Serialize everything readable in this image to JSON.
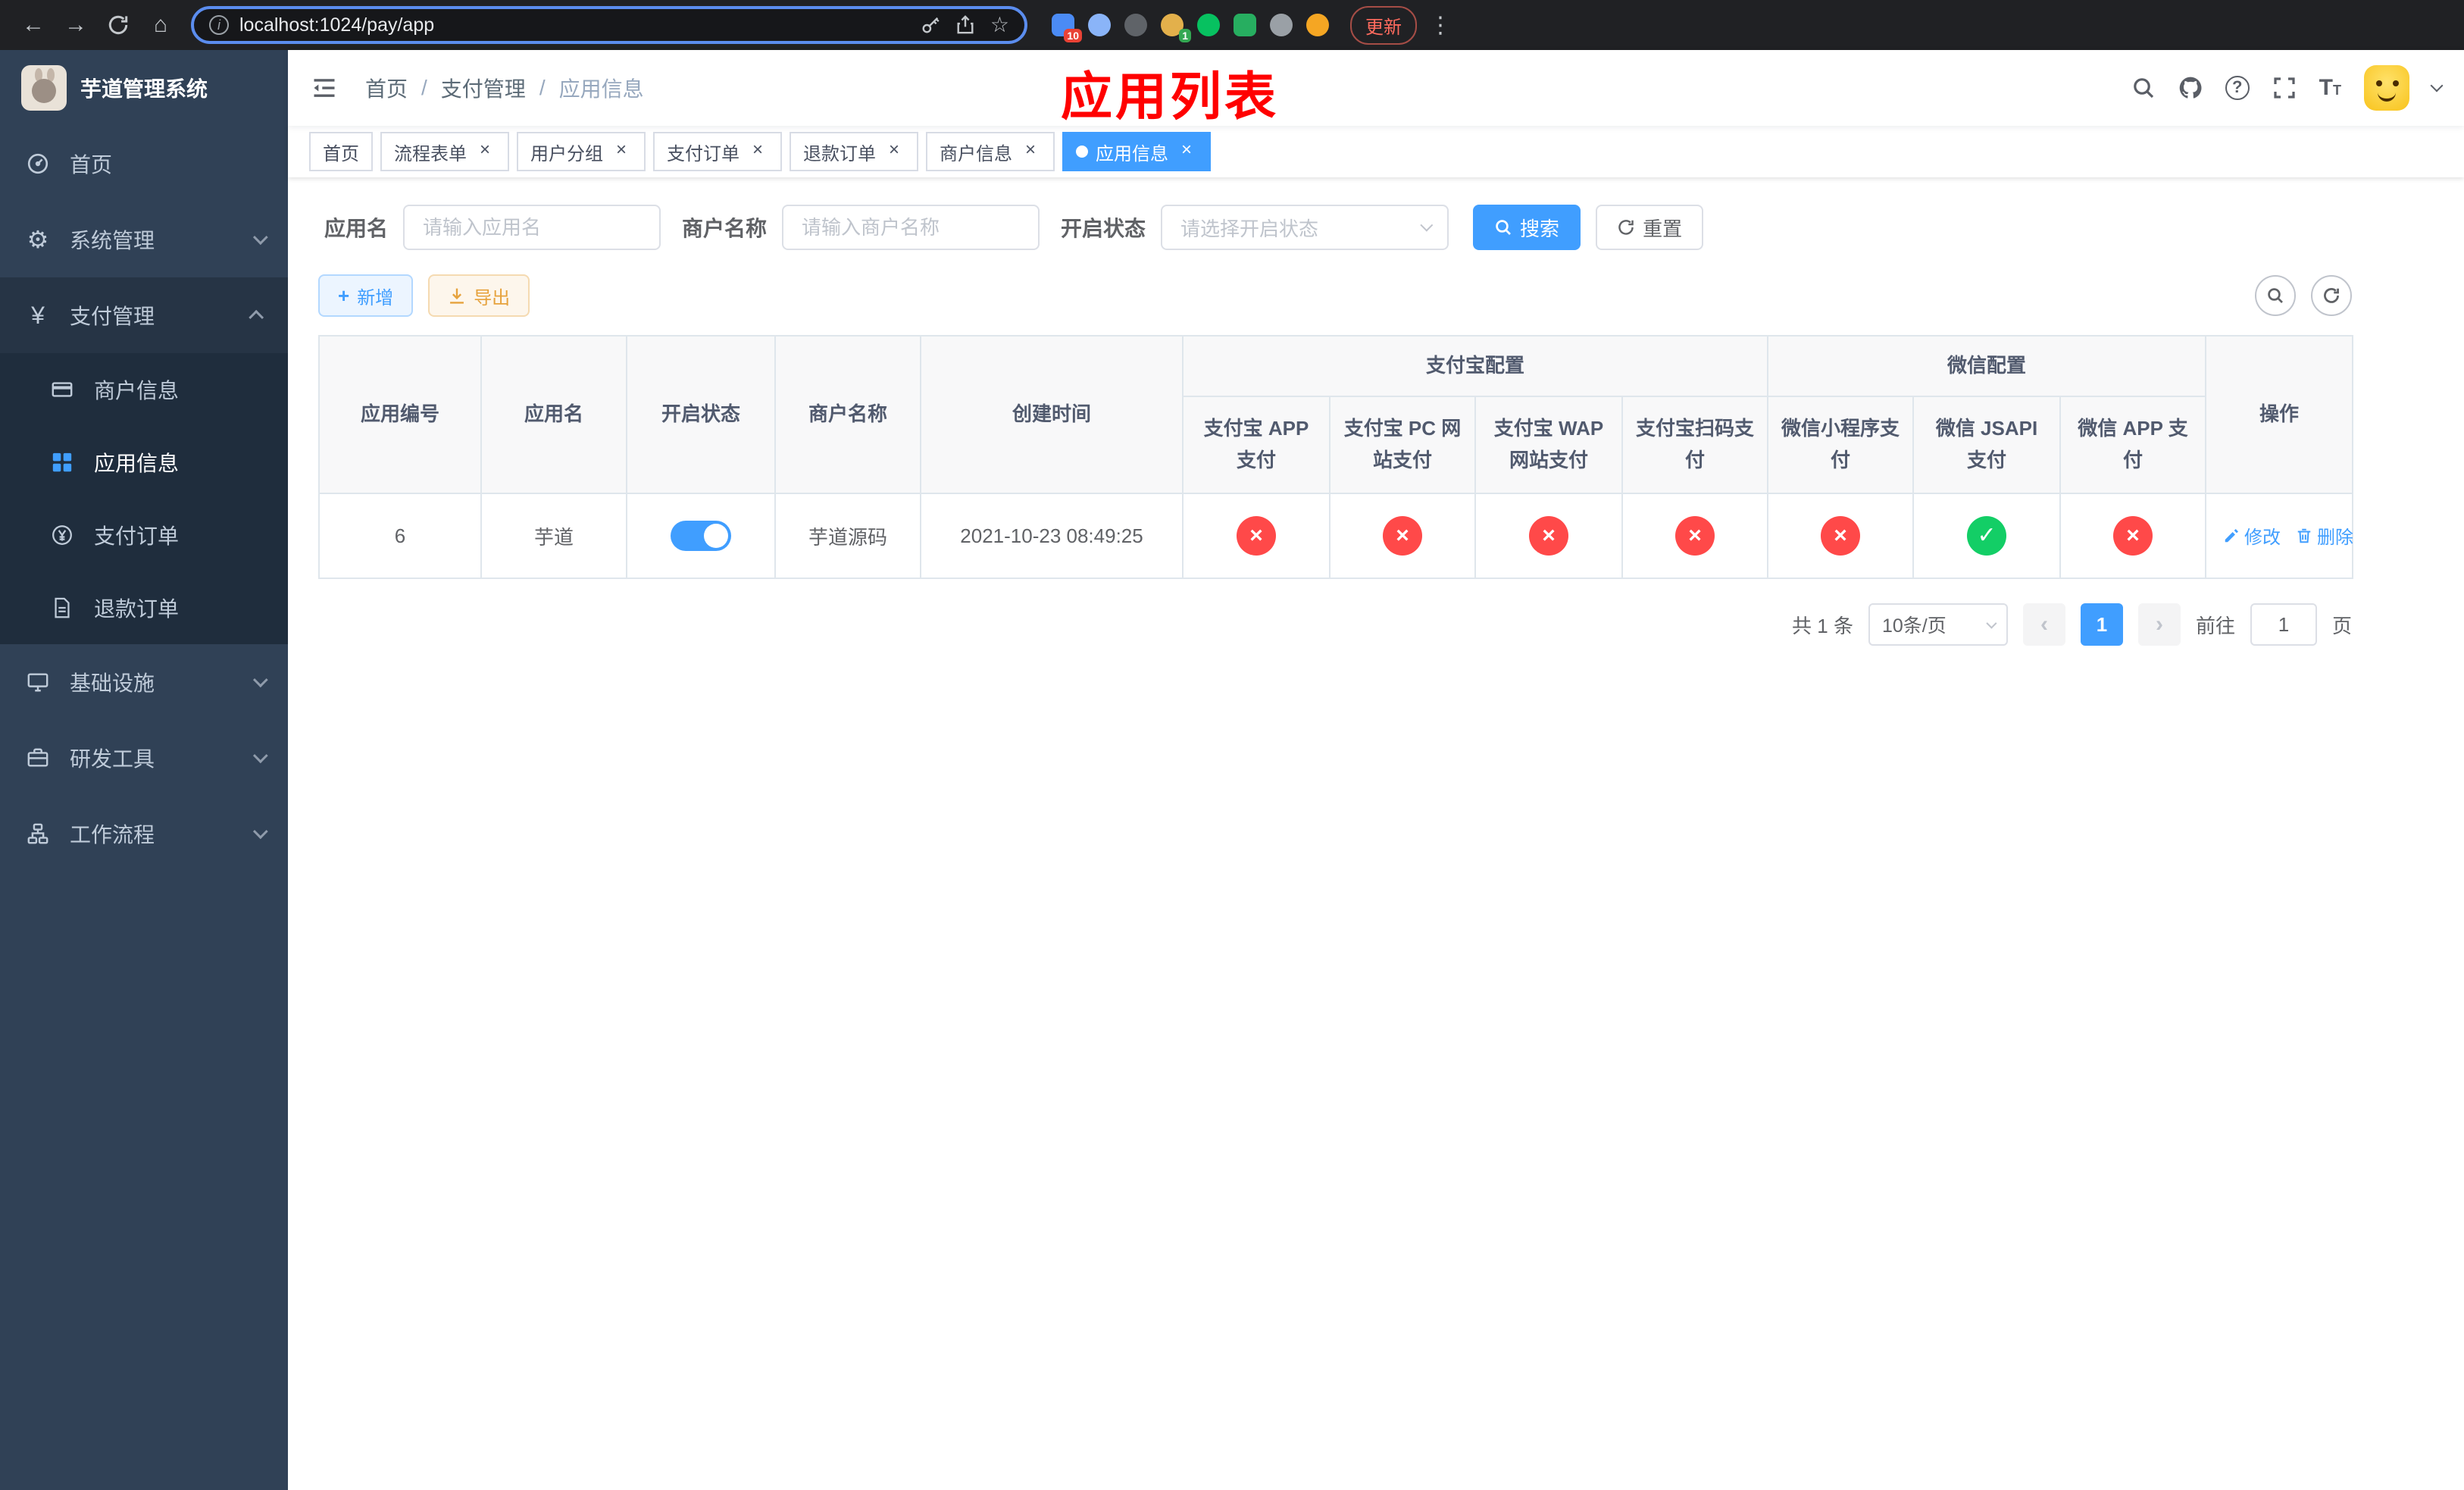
{
  "browser": {
    "url": "localhost:1024/pay/app",
    "update_button": "更新",
    "ext_badge_a": "10",
    "ext_badge_b": "1"
  },
  "sidebar": {
    "title": "芋道管理系统",
    "menu": [
      {
        "label": "首页"
      },
      {
        "label": "系统管理"
      },
      {
        "label": "支付管理"
      },
      {
        "label": "基础设施"
      },
      {
        "label": "研发工具"
      },
      {
        "label": "工作流程"
      }
    ],
    "submenu": [
      {
        "label": "商户信息"
      },
      {
        "label": "应用信息"
      },
      {
        "label": "支付订单"
      },
      {
        "label": "退款订单"
      }
    ]
  },
  "navbar": {
    "breadcrumb": [
      "首页",
      "支付管理",
      "应用信息"
    ],
    "breadcrumb_separator": "/",
    "annotation": "应用列表"
  },
  "tabs": [
    {
      "label": "首页",
      "closable": false,
      "active": false
    },
    {
      "label": "流程表单",
      "closable": true,
      "active": false
    },
    {
      "label": "用户分组",
      "closable": true,
      "active": false
    },
    {
      "label": "支付订单",
      "closable": true,
      "active": false
    },
    {
      "label": "退款订单",
      "closable": true,
      "active": false
    },
    {
      "label": "商户信息",
      "closable": true,
      "active": false
    },
    {
      "label": "应用信息",
      "closable": true,
      "active": true
    }
  ],
  "filters": {
    "app_name_label": "应用名",
    "app_name_placeholder": "请输入应用名",
    "merchant_label": "商户名称",
    "merchant_placeholder": "请输入商户名称",
    "status_label": "开启状态",
    "status_placeholder": "请选择开启状态",
    "search_button": "搜索",
    "reset_button": "重置"
  },
  "toolbar": {
    "add_button": "新增",
    "export_button": "导出"
  },
  "table": {
    "headers": {
      "app_id": "应用编号",
      "app_name": "应用名",
      "status": "开启状态",
      "merchant": "商户名称",
      "created": "创建时间",
      "alipay_group": "支付宝配置",
      "alipay_app": "支付宝 APP 支付",
      "alipay_pc": "支付宝 PC 网站支付",
      "alipay_wap": "支付宝 WAP 网站支付",
      "alipay_scan": "支付宝扫码支付",
      "wechat_group": "微信配置",
      "wechat_mini": "微信小程序支付",
      "wechat_jsapi": "微信 JSAPI 支付",
      "wechat_app": "微信 APP 支付",
      "actions": "操作"
    },
    "rows": [
      {
        "app_id": "6",
        "app_name": "芋道",
        "status_on": true,
        "merchant": "芋道源码",
        "created": "2021-10-23 08:49:25",
        "alipay_app": "disabled",
        "alipay_pc": "disabled",
        "alipay_wap": "disabled",
        "alipay_scan": "disabled",
        "wechat_mini": "disabled",
        "wechat_jsapi": "enabled",
        "wechat_app": "disabled",
        "edit_label": "修改",
        "delete_label": "删除"
      }
    ]
  },
  "pagination": {
    "total": "共 1 条",
    "page_size": "10条/页",
    "current_page": "1",
    "goto_label": "前往",
    "goto_value": "1",
    "page_suffix": "页"
  },
  "icons": {
    "cross": "×",
    "check": "✓",
    "close": "×",
    "plus": "+"
  },
  "colors": {
    "accent": "#409eff",
    "success": "#13ce66",
    "danger": "#ff4949",
    "warning": "#e6a23c",
    "sidebar_bg": "#304156",
    "submenu_bg": "#1f2d3d",
    "annotation_red": "#ff0000"
  }
}
